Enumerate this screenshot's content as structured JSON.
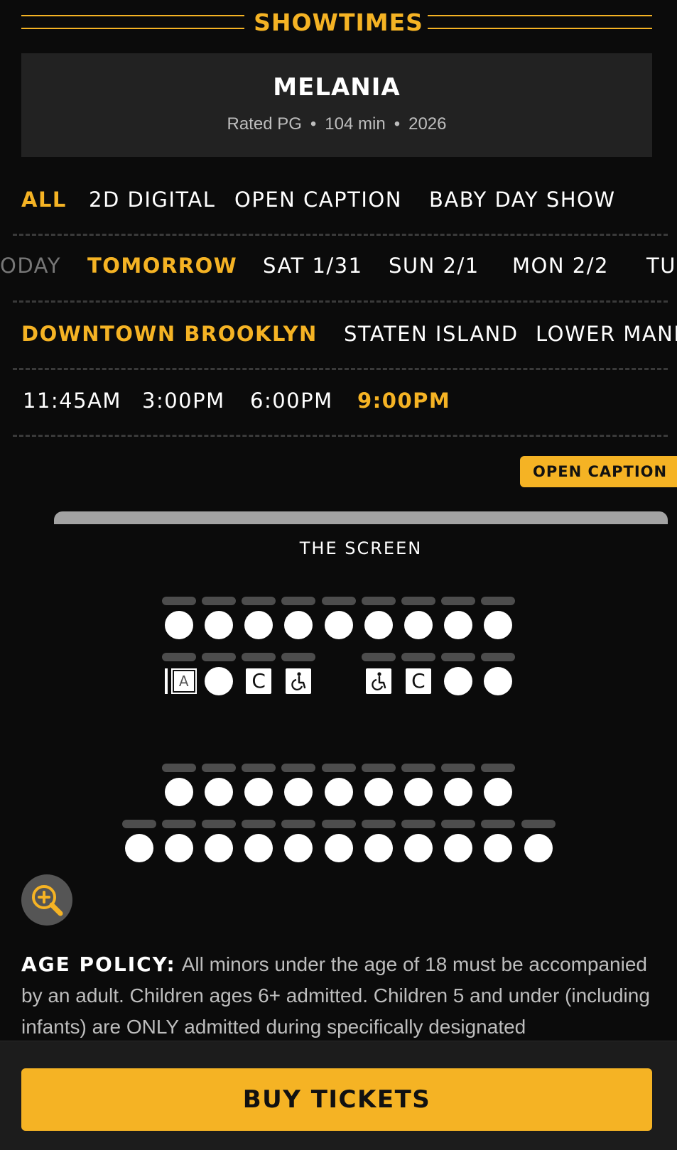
{
  "header": {
    "title": "SHOWTIMES"
  },
  "movie": {
    "title": "MELANIA",
    "rating": "Rated PG",
    "runtime": "104 min",
    "year": "2026",
    "separator": "•"
  },
  "formats": {
    "items": [
      "ALL",
      "2D DIGITAL",
      "OPEN CAPTION",
      "BABY DAY SHOW"
    ],
    "selected": "ALL"
  },
  "dates": {
    "items": [
      "ODAY",
      "TOMORROW",
      "SAT 1/31",
      "SUN 2/1",
      "MON 2/2",
      "TU"
    ],
    "selected": "TOMORROW"
  },
  "locations": {
    "items": [
      "DOWNTOWN BROOKLYN",
      "STATEN ISLAND",
      "LOWER MANH"
    ],
    "selected": "DOWNTOWN BROOKLYN"
  },
  "times": {
    "items": [
      "11:45AM",
      "3:00PM",
      "6:00PM",
      "9:00PM"
    ],
    "selected": "9:00PM"
  },
  "showing_badge": "OPEN CAPTION",
  "screen_label": "THE SCREEN",
  "seat_map": {
    "rows": [
      [
        "seat",
        "seat",
        "seat",
        "seat",
        "seat",
        "seat",
        "seat",
        "seat",
        "seat"
      ],
      [
        "aisle-A",
        "seat",
        "companion",
        "wheelchair",
        "none",
        "wheelchair",
        "companion",
        "seat",
        "seat"
      ],
      [
        "seat",
        "seat",
        "seat",
        "seat",
        "seat",
        "seat",
        "seat",
        "seat",
        "seat"
      ],
      [
        "seat",
        "seat",
        "seat",
        "seat",
        "seat",
        "seat",
        "seat",
        "seat",
        "seat",
        "seat",
        "seat"
      ]
    ],
    "companion_letter": "C",
    "aisle_letter": "A"
  },
  "zoom_icon": "zoom-in-icon",
  "age_policy": {
    "label": "AGE POLICY:",
    "text": "All minors under the age of 18 must be accompanied by an adult. Children ages 6+ admitted. Children 5 and under (including infants) are ONLY admitted during specifically designated"
  },
  "buy_button": "BUY TICKETS",
  "colors": {
    "accent": "#f5b324",
    "background": "#0b0b0b",
    "card": "#222222"
  }
}
